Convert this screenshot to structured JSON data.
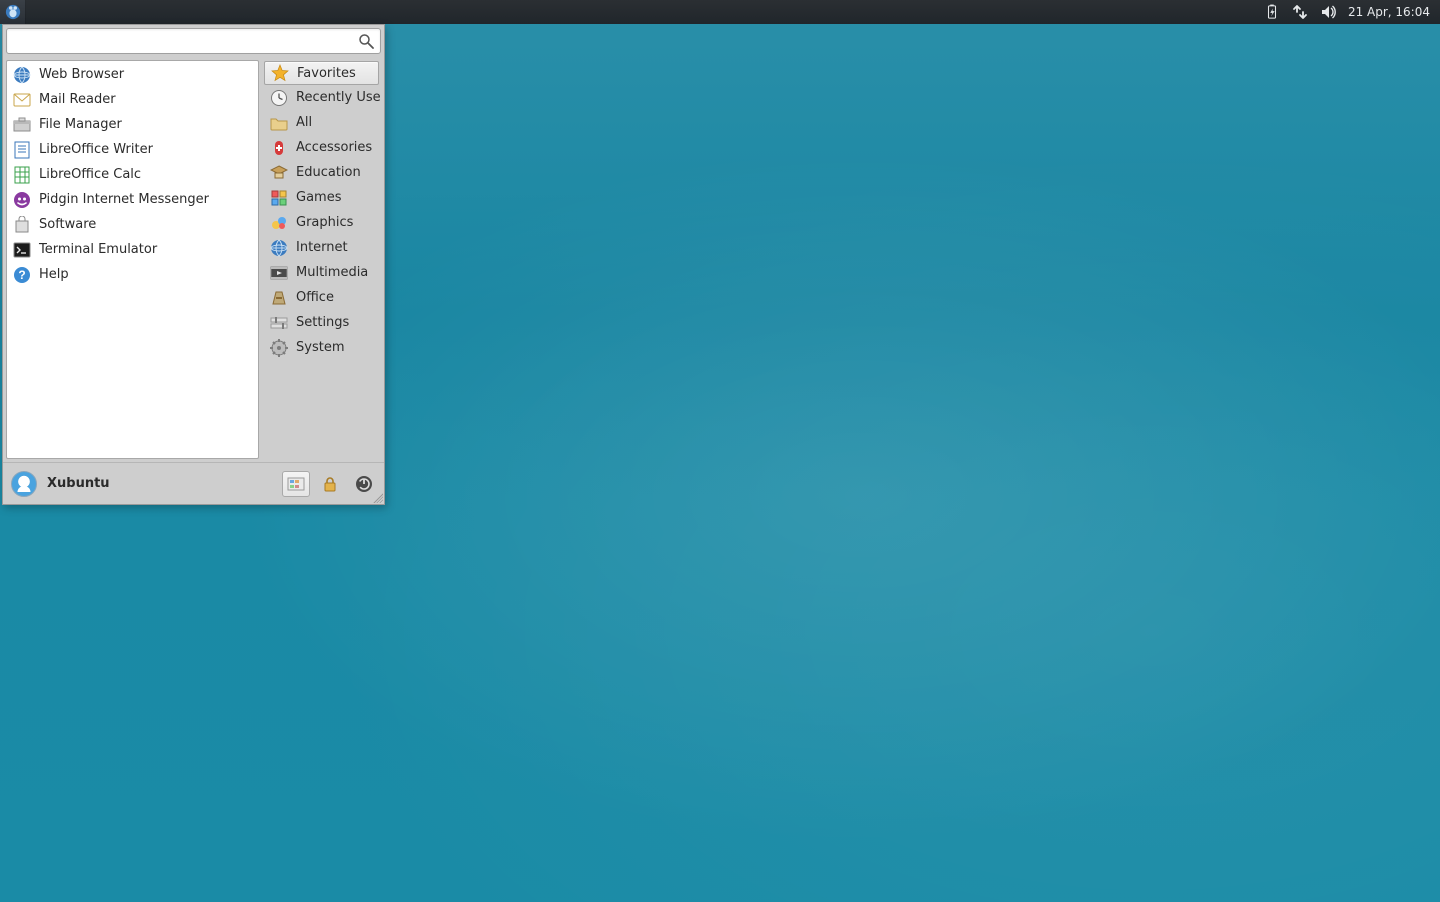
{
  "panel": {
    "clock": "21 Apr, 16:04"
  },
  "menu": {
    "search_placeholder": "",
    "user": "Xubuntu",
    "favorites": [
      {
        "label": "Web Browser",
        "icon": "globe"
      },
      {
        "label": "Mail Reader",
        "icon": "mail"
      },
      {
        "label": "File Manager",
        "icon": "folder-drawer"
      },
      {
        "label": "LibreOffice Writer",
        "icon": "doc-writer"
      },
      {
        "label": "LibreOffice Calc",
        "icon": "doc-calc"
      },
      {
        "label": "Pidgin Internet Messenger",
        "icon": "pidgin"
      },
      {
        "label": "Software",
        "icon": "software-bag"
      },
      {
        "label": "Terminal Emulator",
        "icon": "terminal"
      },
      {
        "label": "Help",
        "icon": "help"
      }
    ],
    "categories": [
      {
        "label": "Favorites",
        "icon": "star",
        "selected": true
      },
      {
        "label": "Recently Used",
        "icon": "clock"
      },
      {
        "label": "All",
        "icon": "folder"
      },
      {
        "label": "Accessories",
        "icon": "swiss"
      },
      {
        "label": "Education",
        "icon": "edu"
      },
      {
        "label": "Games",
        "icon": "games"
      },
      {
        "label": "Graphics",
        "icon": "graphics"
      },
      {
        "label": "Internet",
        "icon": "globe"
      },
      {
        "label": "Multimedia",
        "icon": "multimedia"
      },
      {
        "label": "Office",
        "icon": "office"
      },
      {
        "label": "Settings",
        "icon": "settings"
      },
      {
        "label": "System",
        "icon": "system-gear"
      }
    ],
    "footer_buttons": [
      {
        "name": "all-settings-button",
        "icon": "settings-panel"
      },
      {
        "name": "lock-screen-button",
        "icon": "lock"
      },
      {
        "name": "logout-button",
        "icon": "power"
      }
    ]
  }
}
